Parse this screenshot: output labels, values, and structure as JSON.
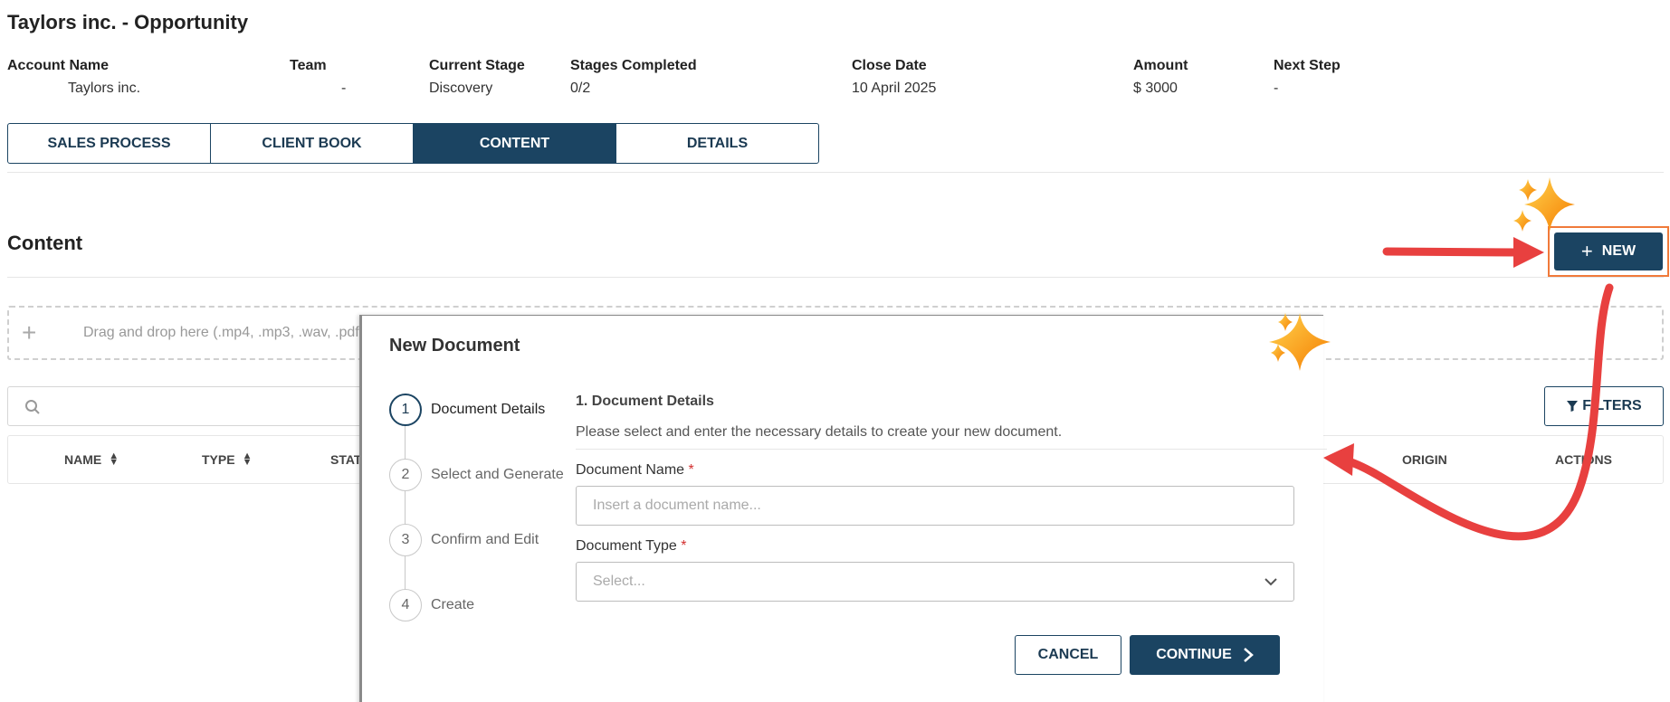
{
  "page": {
    "title": "Taylors inc. - Opportunity"
  },
  "info": {
    "account_name_label": "Account Name",
    "account_name_value": "Taylors inc.",
    "team_label": "Team",
    "team_value": "-",
    "current_stage_label": "Current Stage",
    "current_stage_value": "Discovery",
    "stages_completed_label": "Stages Completed",
    "stages_completed_value": "0/2",
    "close_date_label": "Close Date",
    "close_date_value": "10 April 2025",
    "amount_label": "Amount",
    "amount_value": "$ 3000",
    "next_step_label": "Next Step",
    "next_step_value": "-"
  },
  "tabs": [
    {
      "label": "SALES PROCESS",
      "active": false
    },
    {
      "label": "CLIENT BOOK",
      "active": false
    },
    {
      "label": "CONTENT",
      "active": true
    },
    {
      "label": "DETAILS",
      "active": false
    }
  ],
  "content": {
    "title": "Content",
    "new_button_label": "NEW",
    "dropzone_text": "Drag and drop here (.mp4, .mp3, .wav, .pdf,",
    "filters_label": "FILTERS",
    "columns": {
      "name": "NAME",
      "type": "TYPE",
      "status": "STAT",
      "origin": "ORIGIN",
      "actions": "ACTIONS"
    }
  },
  "modal": {
    "title": "New Document",
    "steps": [
      {
        "number": "1",
        "label": "Document Details",
        "active": true
      },
      {
        "number": "2",
        "label": "Select and Generate",
        "active": false
      },
      {
        "number": "3",
        "label": "Confirm and Edit",
        "active": false
      },
      {
        "number": "4",
        "label": "Create",
        "active": false
      }
    ],
    "section_heading": "1. Document Details",
    "section_description": "Please select and enter the necessary details to create your new document.",
    "document_name_label": "Document Name",
    "document_name_placeholder": "Insert a document name...",
    "document_type_label": "Document Type",
    "document_type_placeholder": "Select...",
    "required_marker": "*",
    "cancel_label": "CANCEL",
    "continue_label": "CONTINUE"
  },
  "colors": {
    "primary": "#1b4462",
    "highlight_border": "#f07a3a",
    "arrow": "#e8403f",
    "sparkle": "#f9a825"
  }
}
